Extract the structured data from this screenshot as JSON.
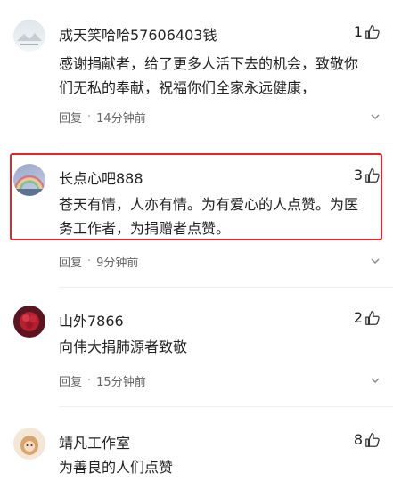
{
  "comments": [
    {
      "username": "成天笑哈哈57606403钱",
      "likes": "1",
      "text_lines": [
        "感谢捐献者，给了更多人活下去的机会，致敬你",
        "们无私的奉献，祝福你们全家永远健康，"
      ],
      "reply_label": "回复",
      "time": "14分钟前",
      "avatar_icon": "landscape-avatar"
    },
    {
      "username": "长点心吧888",
      "likes": "3",
      "text_lines": [
        "苍天有情，人亦有情。为有爱心的人点赞。为医",
        "务工作者，为捐赠者点赞。"
      ],
      "reply_label": "回复",
      "time": "9分钟前",
      "avatar_icon": "rainbow-avatar"
    },
    {
      "username": "山外7866",
      "likes": "2",
      "text_lines": [
        "向伟大捐肺源者致敬"
      ],
      "reply_label": "回复",
      "time": "15分钟前",
      "avatar_icon": "red-flower-avatar"
    },
    {
      "username": "靖凡工作室",
      "likes": "8",
      "text_lines": [
        "为善良的人们点赞"
      ],
      "avatar_icon": "cartoon-avatar"
    }
  ],
  "colors": {
    "highlight_border": "#e0252d",
    "meta_text": "#666666"
  }
}
